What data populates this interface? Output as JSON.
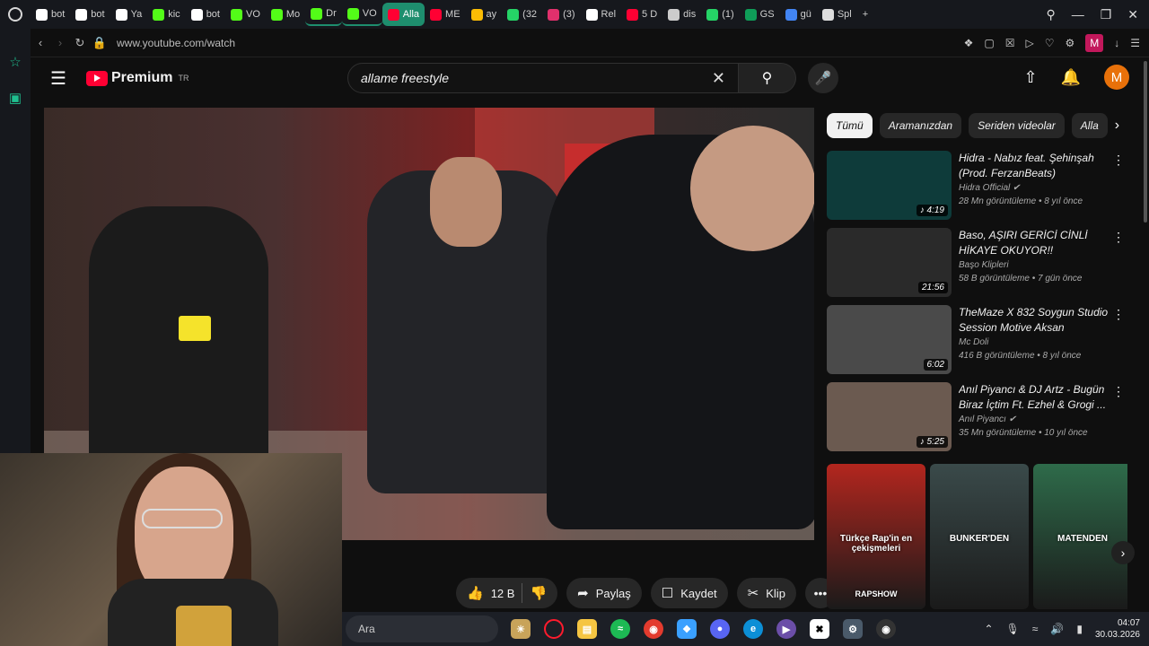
{
  "browser": {
    "tabs": [
      {
        "label": "bot",
        "icon": "shield-icon",
        "color": "#ffffff"
      },
      {
        "label": "bot",
        "icon": "shield-icon",
        "color": "#ffffff"
      },
      {
        "label": "Ya",
        "icon": "shield-icon",
        "color": "#ffffff"
      },
      {
        "label": "kic",
        "icon": "kick-icon",
        "color": "#53fc18"
      },
      {
        "label": "bot",
        "icon": "shield-icon",
        "color": "#ffffff"
      },
      {
        "label": "VO",
        "icon": "kick-icon",
        "color": "#53fc18"
      },
      {
        "label": "Mo",
        "icon": "kick-icon",
        "color": "#53fc18"
      },
      {
        "label": "Dr",
        "icon": "kick-icon",
        "color": "#53fc18"
      },
      {
        "label": "VO",
        "icon": "kick-icon",
        "color": "#53fc18"
      },
      {
        "label": "Alla",
        "icon": "youtube-icon",
        "color": "#ff0033"
      },
      {
        "label": "ME",
        "icon": "youtube-icon",
        "color": "#ff0033"
      },
      {
        "label": "ay",
        "icon": "gdrive-icon",
        "color": "#fbbc04"
      },
      {
        "label": "(32",
        "icon": "whatsapp-icon",
        "color": "#25d366"
      },
      {
        "label": "(3)",
        "icon": "instagram-icon",
        "color": "#e1306c"
      },
      {
        "label": "Rel",
        "icon": "github-icon",
        "color": "#ffffff"
      },
      {
        "label": "5 D",
        "icon": "youtube-icon",
        "color": "#ff0033"
      },
      {
        "label": "dis",
        "icon": "doc-icon",
        "color": "#cccccc"
      },
      {
        "label": "(1)",
        "icon": "chat-icon",
        "color": "#25d366"
      },
      {
        "label": "GS",
        "icon": "sheet-icon",
        "color": "#0f9d58"
      },
      {
        "label": "gü",
        "icon": "google-icon",
        "color": "#4285f4"
      },
      {
        "label": "Spl",
        "icon": "spl-icon",
        "color": "#dddddd"
      }
    ],
    "new_tab": "+",
    "url": "www.youtube.com/watch"
  },
  "youtube": {
    "logo_text": "Premium",
    "region": "TR",
    "search_value": "allame freestyle",
    "avatar_letter": "M",
    "actions": {
      "like_count": "12 B",
      "share": "Paylaş",
      "save": "Kaydet",
      "clip": "Klip"
    },
    "chips": [
      "Tümü",
      "Aramanızdan",
      "Seriden videolar",
      "Alla"
    ],
    "recommendations": [
      {
        "title": "Hidra - Nabız feat. Şehinşah (Prod. FerzanBeats)",
        "channel": "Hidra Official",
        "verified": true,
        "meta": "28 Mn görüntüleme • 8 yıl önce",
        "duration": "4:19",
        "music": true,
        "thumb_color": "#0e3b3a"
      },
      {
        "title": "Baso, AŞIRI GERİCİ CİNLİ HİKAYE OKUYOR!!",
        "channel": "Başo Klipleri",
        "verified": false,
        "meta": "58 B görüntüleme • 7 gün önce",
        "duration": "21:56",
        "music": false,
        "thumb_color": "#2a2a2a"
      },
      {
        "title": "TheMaze X 832 Soygun Studio Session Motive Aksan",
        "channel": "Mc Doli",
        "verified": false,
        "meta": "416 B görüntüleme • 8 yıl önce",
        "duration": "6:02",
        "music": false,
        "thumb_color": "#4a4a4a"
      },
      {
        "title": "Anıl Piyancı & DJ Artz - Bugün Biraz İçtim Ft. Ezhel & Grogi ...",
        "channel": "Anıl Piyancı",
        "verified": true,
        "meta": "35 Mn görüntüleme • 10 yıl önce",
        "duration": "5:25",
        "music": true,
        "thumb_color": "#6b5a50"
      }
    ],
    "shorts": [
      {
        "caption": "Türkçe Rap'in en çekişmeleri",
        "sub": "RAPSHOW",
        "color": "#b3261e"
      },
      {
        "caption": "BUNKER'DEN",
        "sub": "",
        "color": "#3a4a4a"
      },
      {
        "caption": "MATENDEN",
        "sub": "",
        "color": "#2e6b4a"
      }
    ]
  },
  "taskbar": {
    "search_label": "Ara",
    "time": "04:07",
    "date": "30.03.2026"
  }
}
